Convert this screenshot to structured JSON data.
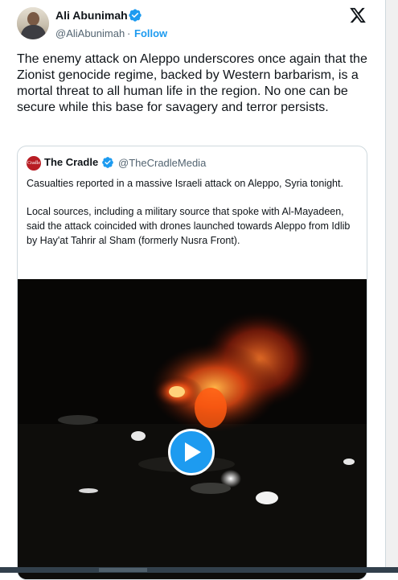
{
  "author": {
    "name": "Ali Abunimah",
    "handle": "@AliAbunimah",
    "separator": "·",
    "follow_label": "Follow",
    "avatar_icon": "person-avatar",
    "verified_icon": "verified-badge-icon"
  },
  "platform_logo": "x-logo-icon",
  "tweet_text": "The enemy attack on Aleppo underscores once again that the Zionist genocide regime, backed by Western barbarism, is a mortal threat to all human life in the region. No one can be secure while this base for savagery and terror persists.",
  "quote": {
    "name": "The Cradle",
    "handle": "@TheCradleMedia",
    "avatar_text": "Cradle",
    "paragraph1": "Casualties reported in a massive Israeli attack on Aleppo, Syria tonight.",
    "paragraph2": "Local sources, including a military source that spoke with Al-Mayadeen, said the attack coincided with drones launched towards Aleppo from Idlib by Hay'at Tahrir al Sham (formerly Nusra Front).",
    "media_type": "video",
    "play_icon": "play-icon"
  },
  "colors": {
    "accent": "#1d9bf0",
    "text": "#0f1419",
    "muted": "#536471",
    "border": "#cfd9de"
  }
}
